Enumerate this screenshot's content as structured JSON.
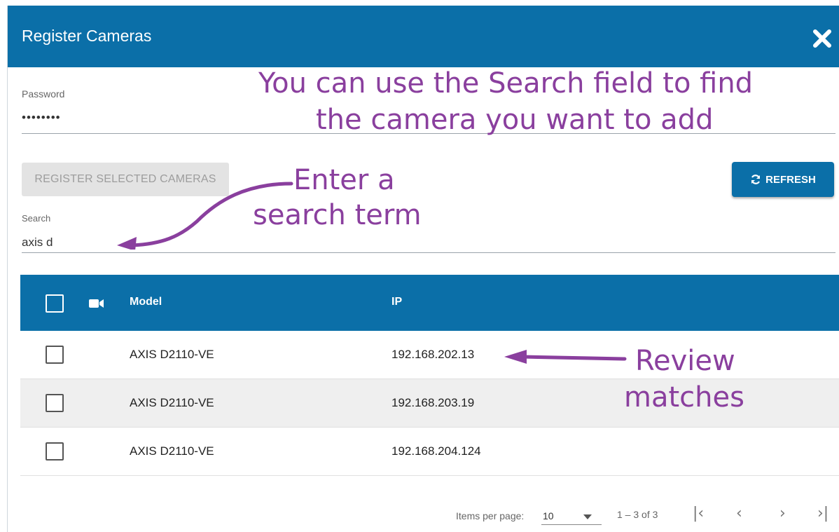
{
  "dialog": {
    "title": "Register Cameras",
    "close_icon": "close-icon"
  },
  "password": {
    "label": "Password",
    "value": "••••••••"
  },
  "annotations": {
    "top_line1": "You can use the  Search field to find",
    "top_line2": "the camera you want to add",
    "search_line1": "Enter a",
    "search_line2": "search term",
    "review_line1": "Review",
    "review_line2": "matches",
    "color": "#8a3f9e"
  },
  "actions": {
    "register_label": "REGISTER SELECTED CAMERAS",
    "refresh_label": "REFRESH",
    "refresh_icon": "refresh-icon"
  },
  "search": {
    "label": "Search",
    "value": "axis d"
  },
  "table": {
    "camera_icon": "video-camera-icon",
    "columns": [
      "Model",
      "IP"
    ],
    "rows": [
      {
        "model": "AXIS D2110-VE",
        "ip": "192.168.202.13"
      },
      {
        "model": "AXIS D2110-VE",
        "ip": "192.168.203.19"
      },
      {
        "model": "AXIS D2110-VE",
        "ip": "192.168.204.124"
      }
    ]
  },
  "paginator": {
    "items_per_page_label": "Items per page:",
    "page_size": "10",
    "range": "1 – 3 of 3",
    "first_icon": "first-page-icon",
    "prev_icon": "previous-page-icon",
    "next_icon": "next-page-icon",
    "last_icon": "last-page-icon"
  },
  "colors": {
    "header_blue": "#0b6fa8",
    "alt_row": "#efefef"
  }
}
